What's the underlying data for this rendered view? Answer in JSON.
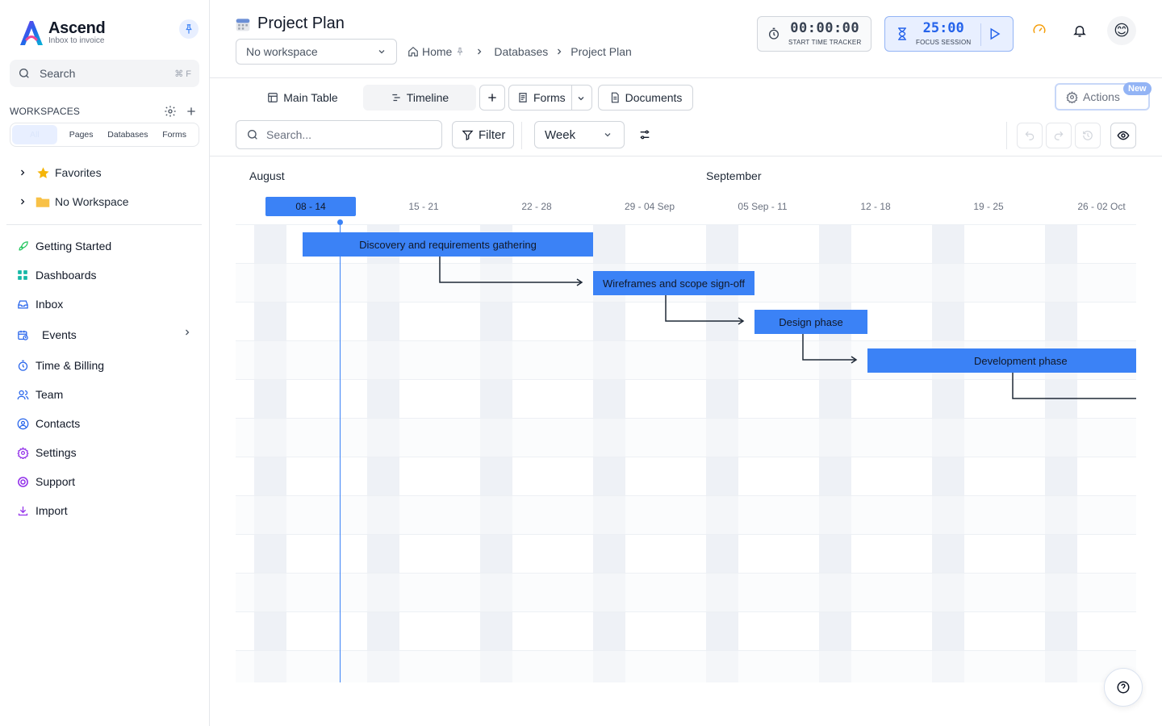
{
  "app": {
    "name": "Ascend",
    "tagline": "Inbox to invoice"
  },
  "sidebar": {
    "search_label": "Search",
    "search_shortcut": "⌘ F",
    "workspaces_title": "WORKSPACES",
    "workspace_filters": [
      "All",
      "Pages",
      "Databases",
      "Forms"
    ],
    "tree": [
      {
        "label": "Favorites",
        "icon": "star-icon",
        "color": "#f5b50a"
      },
      {
        "label": "No Workspace",
        "icon": "folder-icon",
        "color": "#f8c147"
      }
    ],
    "nav": [
      {
        "label": "Getting Started",
        "icon": "rocket-icon",
        "color": "#22c55e"
      },
      {
        "label": "Dashboards",
        "icon": "dashboard-icon",
        "color": "#14b8a6"
      },
      {
        "label": "Inbox",
        "icon": "inbox-icon",
        "color": "#2563eb"
      },
      {
        "label": "Events",
        "icon": "calendar-clock-icon",
        "color": "#2563eb"
      },
      {
        "label": "Time & Billing",
        "icon": "stopwatch-icon",
        "color": "#2563eb"
      },
      {
        "label": "Team",
        "icon": "team-icon",
        "color": "#2563eb"
      },
      {
        "label": "Contacts",
        "icon": "contact-icon",
        "color": "#2563eb"
      },
      {
        "label": "Settings",
        "icon": "gear-icon",
        "color": "#9333ea"
      },
      {
        "label": "Support",
        "icon": "lifebuoy-icon",
        "color": "#9333ea"
      },
      {
        "label": "Import",
        "icon": "download-icon",
        "color": "#9333ea"
      }
    ]
  },
  "header": {
    "title": "Project Plan",
    "workspace_select": "No workspace",
    "breadcrumbs": [
      "Home",
      "Databases",
      "Project Plan"
    ],
    "time_tracker": {
      "value": "00:00:00",
      "label": "START TIME TRACKER"
    },
    "focus_session": {
      "value": "25:00",
      "label": "FOCUS SESSION"
    },
    "avatar_emoji": "😊"
  },
  "toolbar": {
    "tabs": [
      "Main Table",
      "Timeline"
    ],
    "active_tab": "Timeline",
    "forms_label": "Forms",
    "documents_label": "Documents",
    "actions_label": "Actions",
    "new_badge": "New",
    "search_placeholder": "Search...",
    "filter_label": "Filter",
    "period_select": "Week"
  },
  "timeline": {
    "months": [
      "August",
      "September"
    ],
    "weeks": [
      "08 - 14",
      "15 - 21",
      "22 - 28",
      "29 - 04 Sep",
      "05 Sep - 11",
      "12 - 18",
      "19 - 25",
      "26 - 02 Oct"
    ],
    "current_week": "08 - 14",
    "tasks": [
      {
        "name": "Discovery and requirements gathering"
      },
      {
        "name": "Wireframes and scope sign-off"
      },
      {
        "name": "Design phase"
      },
      {
        "name": "Development phase"
      }
    ],
    "bar_color": "#3b82f6"
  }
}
